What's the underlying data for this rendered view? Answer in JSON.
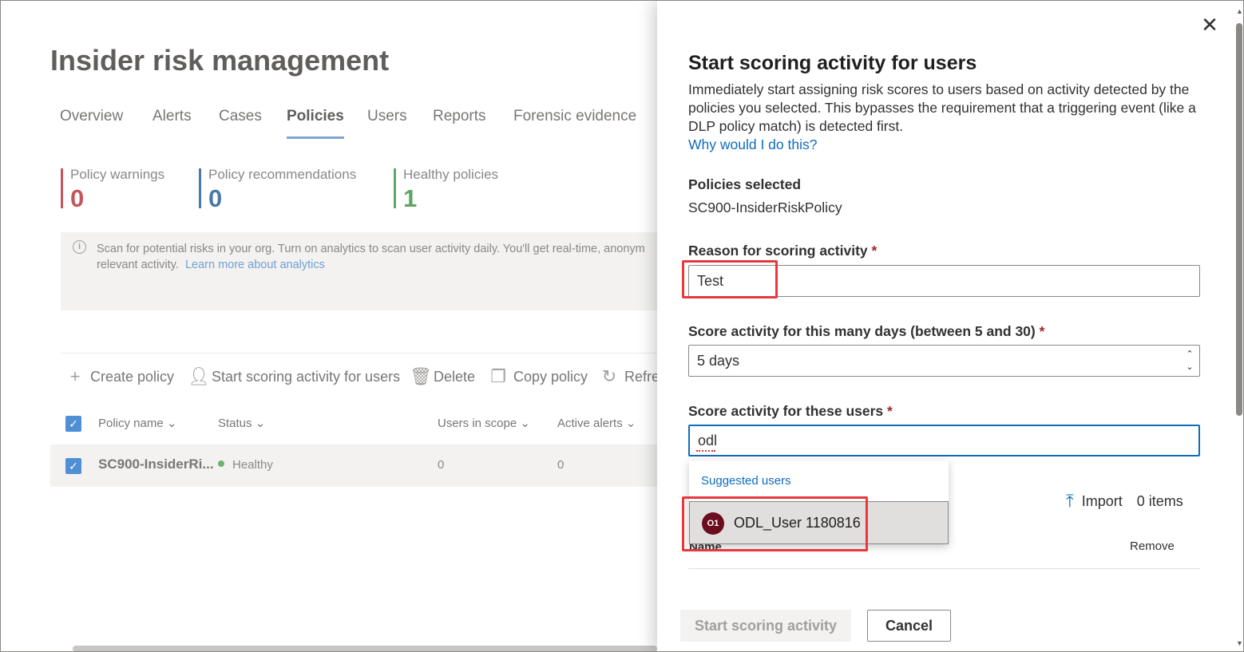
{
  "app": {
    "title": "Insider risk management",
    "tabs": [
      "Overview",
      "Alerts",
      "Cases",
      "Policies",
      "Users",
      "Reports",
      "Forensic evidence"
    ],
    "active_tab": "Policies"
  },
  "metrics": [
    {
      "label": "Policy warnings",
      "value": "0",
      "color": "#c65459"
    },
    {
      "label": "Policy recommendations",
      "value": "0",
      "color": "#4a79a8"
    },
    {
      "label": "Healthy policies",
      "value": "1",
      "color": "#5fa563"
    }
  ],
  "notice": {
    "text1": "Scan for potential risks in your org. Turn on analytics to scan user activity daily. You'll get real-time, anonym",
    "text2": "relevant activity.",
    "link": "Learn more about analytics"
  },
  "commands": {
    "create": "Create policy",
    "start": "Start scoring activity for users",
    "delete": "Delete",
    "copy": "Copy policy",
    "refresh": "Refre"
  },
  "table": {
    "columns": [
      "Policy name",
      "Status",
      "Users in scope",
      "Active alerts"
    ],
    "rows": [
      {
        "name": "SC900-InsiderRi...",
        "status": "Healthy",
        "users": "0",
        "alerts": "0"
      }
    ]
  },
  "panel": {
    "title": "Start scoring activity for users",
    "description": "Immediately start assigning risk scores to users based on activity detected by the policies you selected. This bypasses the requirement that a triggering event (like a DLP policy match) is detected first.",
    "why_link": "Why would I do this?",
    "policies_label": "Policies selected",
    "policies_value": "SC900-InsiderRiskPolicy",
    "reason_label": "Reason for scoring activity",
    "reason_value": "Test",
    "days_label": "Score activity for this many days (between 5 and 30)",
    "days_value": "5 days",
    "users_label": "Score activity for these users",
    "users_value": "odl",
    "required_mark": "*",
    "suggested_header": "Suggested users",
    "suggested_user": {
      "initials": "O1",
      "name": "ODL_User 1180816"
    },
    "import_label": "Import",
    "items_count": "0 items",
    "name_col": "Name",
    "remove_col": "Remove",
    "start_button": "Start scoring activity",
    "cancel_button": "Cancel"
  }
}
